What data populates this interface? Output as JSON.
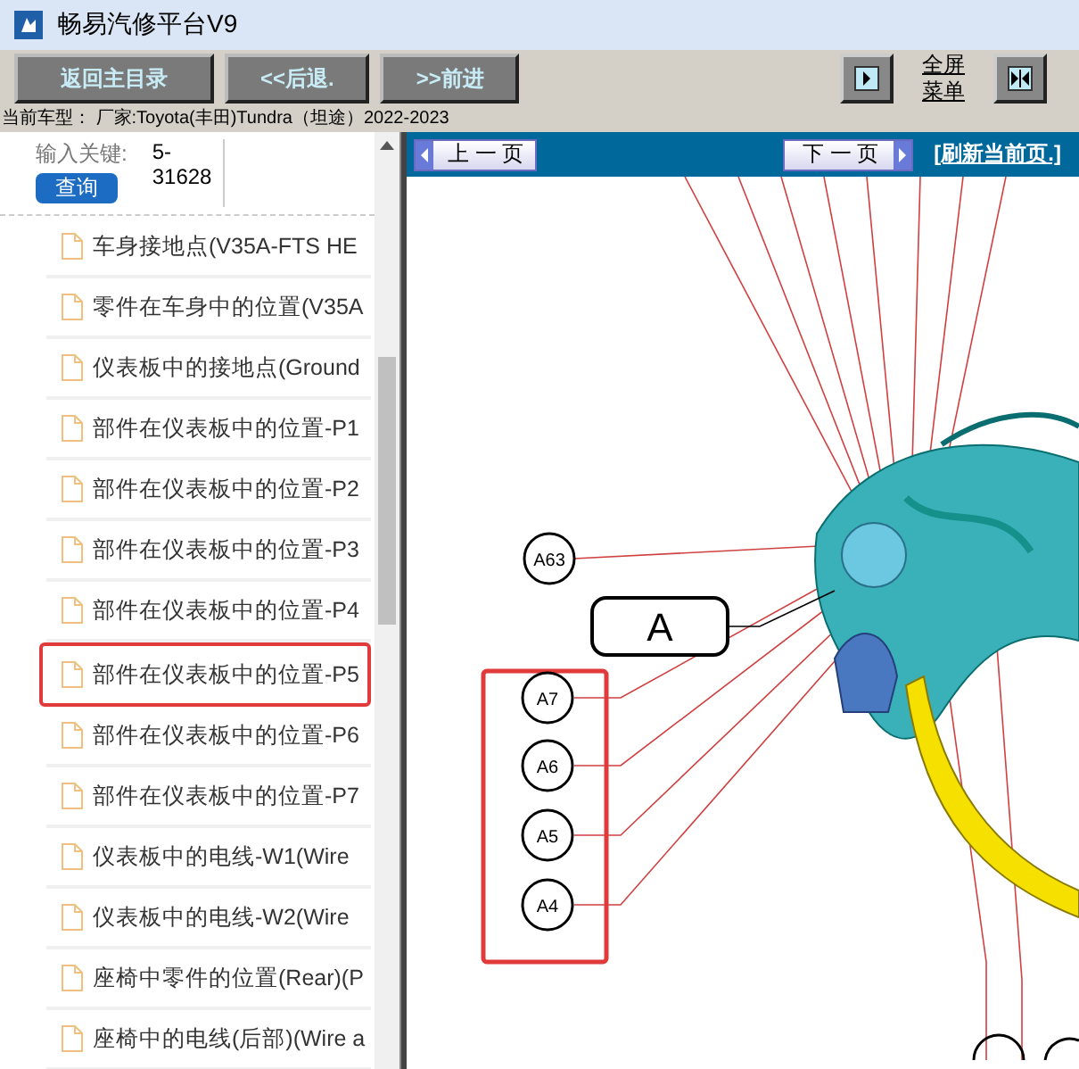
{
  "window": {
    "title": "畅易汽修平台V9"
  },
  "toolbar": {
    "buttons": [
      "返回主目录",
      "<<后退.",
      ">>前进"
    ],
    "menu_link": "全屏菜单"
  },
  "vehicle_info": "当前车型： 厂家:Toyota(丰田)Tundra（坦途）2022-2023",
  "search": {
    "label": "输入关键:",
    "value": "5-31628",
    "button": "查询"
  },
  "tree": [
    {
      "label": "车身接地点(V35A-FTS HE",
      "selected": false
    },
    {
      "label": "零件在车身中的位置(V35A",
      "selected": false
    },
    {
      "label": "仪表板中的接地点(Ground",
      "selected": false
    },
    {
      "label": "部件在仪表板中的位置-P1",
      "selected": false
    },
    {
      "label": "部件在仪表板中的位置-P2",
      "selected": false
    },
    {
      "label": "部件在仪表板中的位置-P3",
      "selected": false
    },
    {
      "label": "部件在仪表板中的位置-P4",
      "selected": false
    },
    {
      "label": "部件在仪表板中的位置-P5",
      "selected": true
    },
    {
      "label": "部件在仪表板中的位置-P6",
      "selected": false
    },
    {
      "label": "部件在仪表板中的位置-P7",
      "selected": false
    },
    {
      "label": "仪表板中的电线-W1(Wire",
      "selected": false
    },
    {
      "label": "仪表板中的电线-W2(Wire",
      "selected": false
    },
    {
      "label": "座椅中零件的位置(Rear)(P",
      "selected": false
    },
    {
      "label": "座椅中的电线(后部)(Wire a",
      "selected": false
    }
  ],
  "viewer": {
    "prev": "上 一 页",
    "next": "下 一 页",
    "refresh": "[刷新当前页.]",
    "callouts": [
      {
        "text": "A63",
        "kind": "circle"
      },
      {
        "text": "A",
        "kind": "box"
      },
      {
        "text": "A7",
        "kind": "circle"
      },
      {
        "text": "A6",
        "kind": "circle"
      },
      {
        "text": "A5",
        "kind": "circle"
      },
      {
        "text": "A4",
        "kind": "circle"
      }
    ]
  }
}
